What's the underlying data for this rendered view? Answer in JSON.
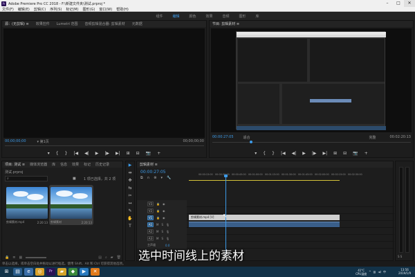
{
  "window": {
    "title": "Adobe Premiere Pro CC 2018 - F:\\新建文件夹\\测试.prproj *",
    "min": "–",
    "max": "□",
    "close": "✕"
  },
  "menu": [
    "文件(F)",
    "编辑(E)",
    "剪辑(C)",
    "序列(S)",
    "标记(M)",
    "图形(G)",
    "窗口(W)",
    "帮助(H)"
  ],
  "workspace_tabs": [
    "组件",
    "编辑",
    "颜色",
    "效果",
    "音频",
    "图形",
    "库"
  ],
  "workspace_active": 1,
  "source_monitor": {
    "tabs": [
      "源：(无剪辑) ≡",
      "效果控件",
      "Lumetri 范围",
      "音频剪辑混合器: 剪辑素材",
      "元数据"
    ],
    "timecode_left": "00;00;00;00",
    "fit": "▾ 第1页",
    "timecode_right": "00;00;00;00"
  },
  "program_monitor": {
    "tab": "节目: 剪辑素材 ≡",
    "timecode_left": "00:00:27:05",
    "fit": "适合",
    "quality": "完整",
    "timecode_right": "00:02:20:13"
  },
  "transport_icons": [
    "▾",
    "{",
    "}",
    "|◀",
    "◀|",
    "▶",
    "|▶",
    "▶|",
    "⊞",
    "⊟",
    "📷",
    "+"
  ],
  "project": {
    "tabs": [
      "项目: 测试 ≡",
      "媒体浏览器",
      "库",
      "信息",
      "效果",
      "标记",
      "历史记录"
    ],
    "filename": "测试.prproj",
    "items_count": "1 项已选择，共 2 项",
    "items": [
      {
        "name": "剪辑素材.mp4",
        "duration": "2:20:13"
      },
      {
        "name": "剪辑素材",
        "duration": "2:20:13"
      }
    ]
  },
  "tools": [
    "▶",
    "⇹",
    "✥",
    "⇆",
    "✂",
    "↔",
    "✎",
    "✋",
    "T"
  ],
  "timeline": {
    "tab": "剪辑素材 ≡",
    "timecode": "00:00:27:05",
    "ruler": [
      "00:00",
      "00:00:15:00",
      "00:00:30:00",
      "00:00:45:00",
      "00:01:00:00",
      "00:01:15:00",
      "00:01:30:00",
      "00:01:45:00",
      "00:02:00:00",
      "00:02:15:00",
      "00:02:30:00"
    ],
    "video_tracks": [
      "V3",
      "V2",
      "V1"
    ],
    "audio_tracks": [
      "A1",
      "A2",
      "A3"
    ],
    "master_label": "主声道",
    "master_value": "0.0",
    "clip_label": "剪辑素材.mp4 [V]",
    "playhead_fraction": 0.18
  },
  "status_text": "单击以选择，或单击空白处并拖动以进行框选。使用 Shift、Alt 和 Ctrl 可获得其他选项。",
  "subtitle": "选中时间线上的素材",
  "taskbar": {
    "time": "13:56",
    "date": "2019/1/9",
    "temp": "41°C",
    "cpu": "CPU温度",
    "lang": "中"
  },
  "colors": {
    "accent": "#3d9be9",
    "clip_video": "#cfcfcf",
    "clip_audio": "#3a5f8a",
    "taskbar": "#123248"
  }
}
